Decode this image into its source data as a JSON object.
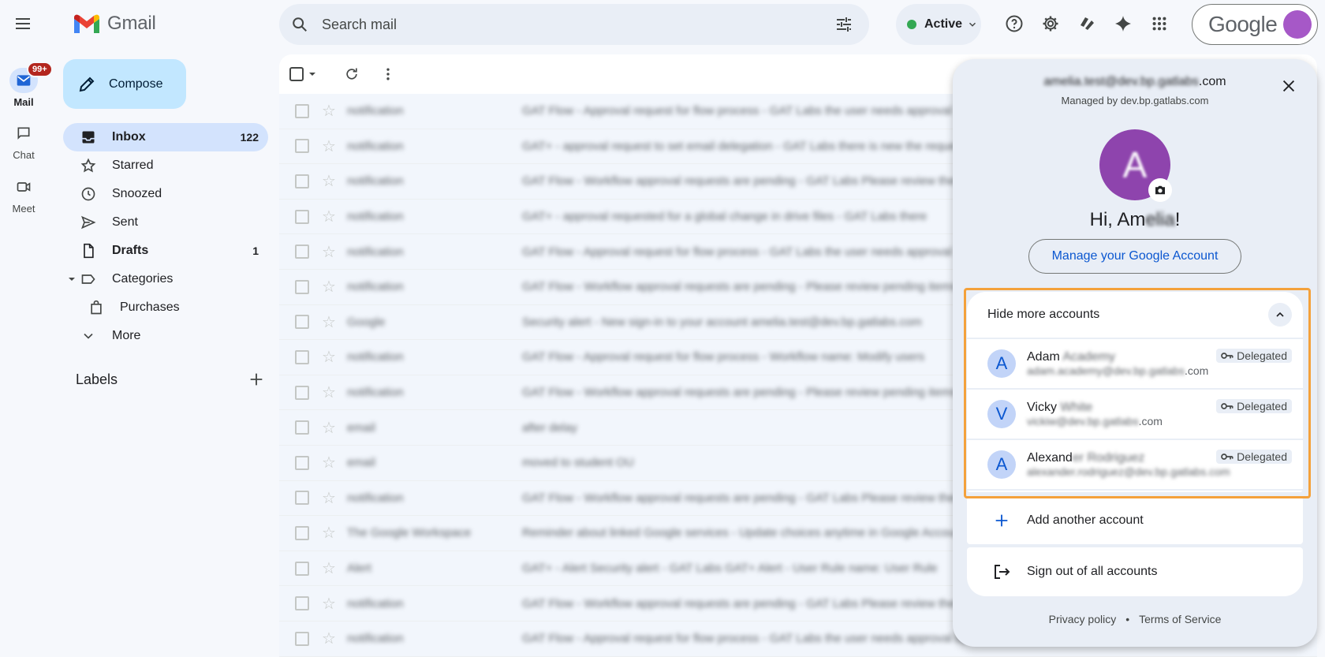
{
  "rail": {
    "badge": "99+",
    "mail": "Mail",
    "chat": "Chat",
    "meet": "Meet"
  },
  "logo": {
    "text": "Gmail"
  },
  "search": {
    "placeholder": "Search mail"
  },
  "status": {
    "label": "Active",
    "color": "#34a853"
  },
  "account_chip": {
    "brand": "Google"
  },
  "compose": {
    "label": "Compose"
  },
  "nav": {
    "inbox": {
      "label": "Inbox",
      "count": "122"
    },
    "starred": {
      "label": "Starred"
    },
    "snoozed": {
      "label": "Snoozed"
    },
    "sent": {
      "label": "Sent"
    },
    "drafts": {
      "label": "Drafts",
      "count": "1"
    },
    "categories": {
      "label": "Categories"
    },
    "purchases": {
      "label": "Purchases"
    },
    "more": {
      "label": "More"
    }
  },
  "labels": {
    "title": "Labels"
  },
  "mail_rows": [
    {
      "sender": "notification",
      "subject": "GAT Flow - Approval request for flow process - GAT Labs the user needs approval"
    },
    {
      "sender": "notification",
      "subject": "GAT+ - approval request to set email delegation - GAT Labs there is new the request"
    },
    {
      "sender": "notification",
      "subject": "GAT Flow - Workflow approval requests are pending - GAT Labs Please review them"
    },
    {
      "sender": "notification",
      "subject": "GAT+ - approval requested for a global change in drive files - GAT Labs there"
    },
    {
      "sender": "notification",
      "subject": "GAT Flow - Approval request for flow process - GAT Labs the user needs approval"
    },
    {
      "sender": "notification",
      "subject": "GAT Flow - Workflow approval requests are pending - Please review pending items"
    },
    {
      "sender": "Google",
      "subject": "Security alert - New sign-in to your account amelia.test@dev.bp.gatlabs.com"
    },
    {
      "sender": "notification",
      "subject": "GAT Flow - Approval request for flow process - Workflow name: Modify users"
    },
    {
      "sender": "notification",
      "subject": "GAT Flow - Workflow approval requests are pending - Please review pending items"
    },
    {
      "sender": "email",
      "subject": "after delay"
    },
    {
      "sender": "email",
      "subject": "moved to student OU"
    },
    {
      "sender": "notification",
      "subject": "GAT Flow - Workflow approval requests are pending - GAT Labs Please review them"
    },
    {
      "sender": "The Google Workspace",
      "subject": "Reminder about linked Google services - Update choices anytime in Google Account"
    },
    {
      "sender": "Alert",
      "subject": "GAT+ - Alert Security alert - GAT Labs GAT+ Alert - User Rule name: User Rule"
    },
    {
      "sender": "notification",
      "subject": "GAT Flow - Workflow approval requests are pending - GAT Labs Please review them"
    },
    {
      "sender": "notification",
      "subject": "GAT Flow - Approval request for flow process - GAT Labs the user needs approval bp"
    }
  ],
  "panel": {
    "email_hidden": "amelia.test@dev.bp.gatlabs",
    "email_suffix": ".com",
    "managed_by": "Managed by dev.bp.gatlabs.com",
    "avatar_letter": "A",
    "greeting_start": "Hi, Am",
    "greeting_hidden": "elia",
    "greeting_end": "!",
    "manage_button": "Manage your Google Account",
    "hide_accounts": "Hide more accounts",
    "accounts": [
      {
        "initial": "A",
        "first": "Adam",
        "rest": " Academy",
        "email_hidden": "adam.academy@dev.bp.gatlabs",
        "email_suffix": ".com",
        "badge": "Delegated"
      },
      {
        "initial": "V",
        "first": "Vicky",
        "rest": " White",
        "email_hidden": "vickiw@dev.bp.gatlabs",
        "email_suffix": ".com",
        "badge": "Delegated"
      },
      {
        "initial": "A",
        "first": "Alexand",
        "rest": "er Rodriguez",
        "email_hidden": "alexander.rodriguez@dev.bp.gatlabs.com",
        "email_suffix": "",
        "badge": "Delegated"
      }
    ],
    "add_account": "Add another account",
    "sign_out": "Sign out of all accounts",
    "privacy": "Privacy policy",
    "separator": "•",
    "terms": "Terms of Service"
  },
  "colors": {
    "highlight": "#f4a13b",
    "accent": "#0b57d0",
    "avatar": "#8e44ad"
  }
}
